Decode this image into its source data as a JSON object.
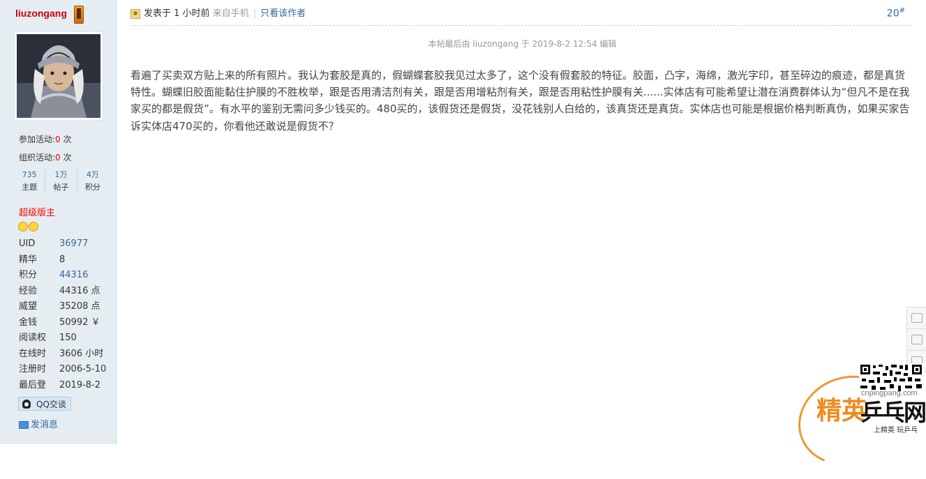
{
  "author": {
    "name": "liuzongang",
    "activities": [
      {
        "label": "参加活动:",
        "count": "0",
        "unit": "次"
      },
      {
        "label": "组织活动:",
        "count": "0",
        "unit": "次"
      }
    ],
    "mini_stats": [
      {
        "value": "735",
        "label": "主题"
      },
      {
        "value": "1万",
        "label": "帖子"
      },
      {
        "value": "4万",
        "label": "积分"
      }
    ],
    "rank": "超级版主",
    "profile": [
      {
        "key": "UID",
        "value": "36977"
      },
      {
        "key": "精华",
        "value": "8"
      },
      {
        "key": "积分",
        "value": "44316"
      },
      {
        "key": "经验",
        "value": "44316 点"
      },
      {
        "key": "威望",
        "value": "35208 点"
      },
      {
        "key": "金钱",
        "value": "50992 ￥"
      },
      {
        "key": "阅读权",
        "value": "150"
      },
      {
        "key": "在线时",
        "value": "3606 小时"
      },
      {
        "key": "注册时",
        "value": "2006-5-10"
      },
      {
        "key": "最后登",
        "value": "2019-8-2"
      }
    ],
    "qq_label": "QQ交谈",
    "message_label": "发消息"
  },
  "post": {
    "posted_text": "发表于 1 小时前",
    "from_text": "来自手机",
    "only_author": "只看该作者",
    "floor": "20",
    "floor_sup": "#",
    "edit_note": "本帖最后由 liuzongang 于 2019-8-2 12:54 编辑",
    "body": "看遍了买卖双方贴上来的所有照片。我认为套胶是真的，假蝴蝶套胶我见过太多了，这个没有假套胶的特征。胶面，凸字，海绵，激光字印，甚至碎边的痕迹，都是真货特性。蝴蝶旧胶面能黏住护膜的不胜枚举，跟是否用清洁剂有关，跟是否用增粘剂有关，跟是否用粘性护膜有关......实体店有可能希望让潜在消费群体认为“但凡不是在我家买的都是假货”。有水平的鉴别无需问多少钱买的。480买的，该假货还是假货，没花钱别人白给的，该真货还是真货。实体店也可能是根据价格判断真伪，如果买家告诉实体店470买的，你看他还敢说是假货不？"
  },
  "watermark": {
    "domain": "cnpingpang.com",
    "logo_part1": "精英",
    "logo_part2": "乒乓网",
    "tagline": "上精英 玩乒乓"
  },
  "colors": {
    "panel_bg": "#e5edf2",
    "link": "#336699",
    "rank": "#ff0000",
    "logo_orange": "#f08a1e"
  }
}
